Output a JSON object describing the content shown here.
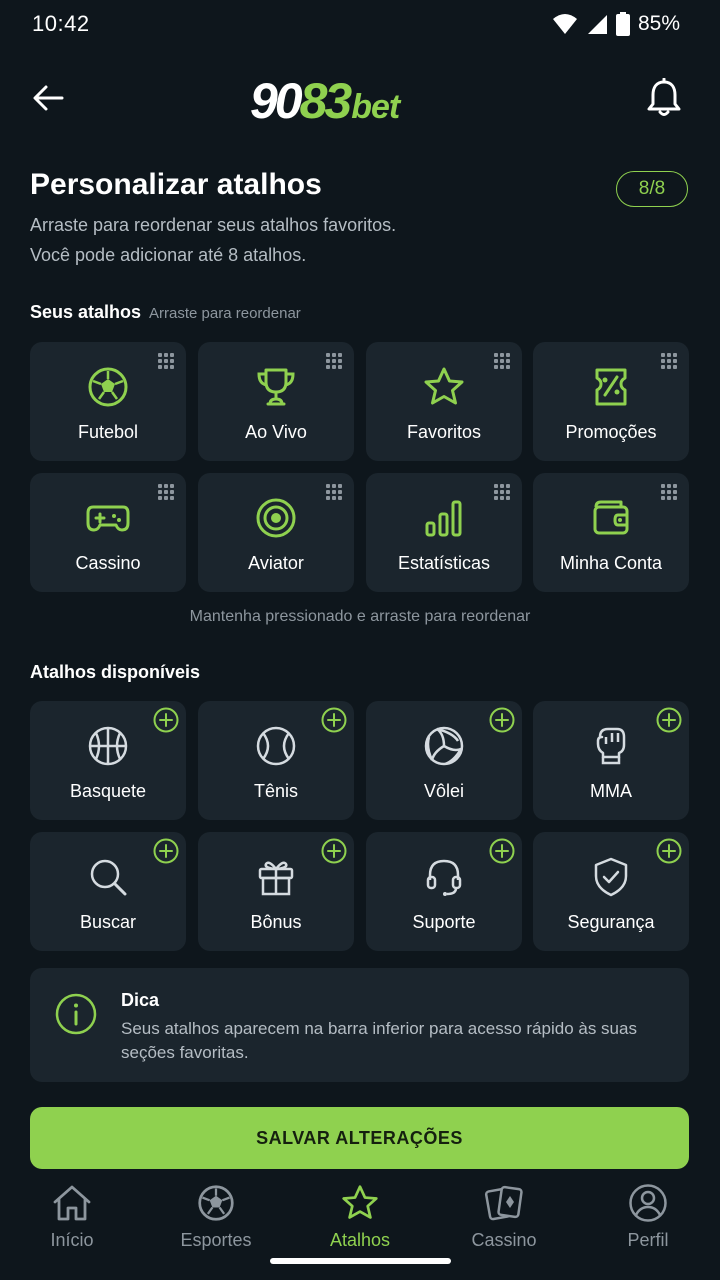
{
  "status": {
    "time": "10:42",
    "battery": "85%"
  },
  "header": {
    "logo_part1": "90",
    "logo_part2": "83",
    "logo_part3": "bet"
  },
  "page": {
    "title": "Personalizar atalhos",
    "count": "8/8",
    "subtitle_line1": "Arraste para reordenar seus atalhos favoritos.",
    "subtitle_line2": "Você pode adicionar até 8 atalhos."
  },
  "my_shortcuts": {
    "heading": "Seus atalhos",
    "hint": "Arraste para reordenar",
    "items": [
      {
        "label": "Futebol",
        "icon": "soccer-ball-icon"
      },
      {
        "label": "Ao Vivo",
        "icon": "trophy-icon"
      },
      {
        "label": "Favoritos",
        "icon": "star-icon"
      },
      {
        "label": "Promoções",
        "icon": "discount-icon"
      },
      {
        "label": "Cassino",
        "icon": "gamepad-icon"
      },
      {
        "label": "Aviator",
        "icon": "target-icon"
      },
      {
        "label": "Estatísticas",
        "icon": "bar-chart-icon"
      },
      {
        "label": "Minha Conta",
        "icon": "wallet-icon"
      }
    ],
    "footer_hint": "Mantenha pressionado e arraste para reordenar"
  },
  "available": {
    "heading": "Atalhos disponíveis",
    "items": [
      {
        "label": "Basquete",
        "icon": "basketball-icon"
      },
      {
        "label": "Tênis",
        "icon": "tennis-ball-icon"
      },
      {
        "label": "Vôlei",
        "icon": "volleyball-icon"
      },
      {
        "label": "MMA",
        "icon": "boxing-glove-icon"
      },
      {
        "label": "Buscar",
        "icon": "search-icon"
      },
      {
        "label": "Bônus",
        "icon": "gift-icon"
      },
      {
        "label": "Suporte",
        "icon": "headset-icon"
      },
      {
        "label": "Segurança",
        "icon": "shield-check-icon"
      }
    ]
  },
  "tip": {
    "title": "Dica",
    "text": "Seus atalhos aparecem na barra inferior para acesso rápido às suas seções favoritas."
  },
  "save_button": "SALVAR ALTERAÇÕES",
  "nav": [
    {
      "label": "Início",
      "icon": "home-icon",
      "active": false
    },
    {
      "label": "Esportes",
      "icon": "soccer-ball-icon",
      "active": false
    },
    {
      "label": "Atalhos",
      "icon": "star-icon",
      "active": true
    },
    {
      "label": "Cassino",
      "icon": "cards-icon",
      "active": false
    },
    {
      "label": "Perfil",
      "icon": "user-icon",
      "active": false
    }
  ],
  "colors": {
    "accent": "#8fd14f",
    "background": "#0e161c",
    "tile": "#1b252d",
    "muted": "#8d969e"
  }
}
